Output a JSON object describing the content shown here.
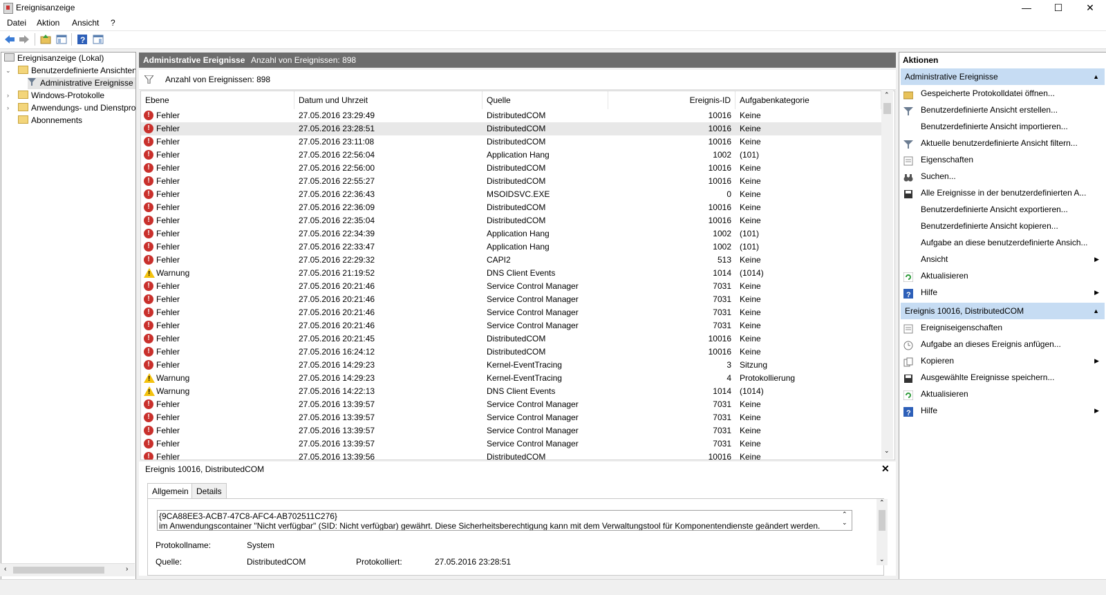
{
  "window": {
    "title": "Ereignisanzeige",
    "min": "—",
    "max": "☐",
    "close": "✕"
  },
  "menu": [
    "Datei",
    "Aktion",
    "Ansicht",
    "?"
  ],
  "tree": [
    {
      "label": "Ereignisanzeige (Lokal)"
    },
    {
      "label": "Benutzerdefinierte Ansichten"
    },
    {
      "label": "Administrative Ereignisse"
    },
    {
      "label": "Windows-Protokolle"
    },
    {
      "label": "Anwendungs- und Dienstprotokolle"
    },
    {
      "label": "Abonnements"
    }
  ],
  "center": {
    "title": "Administrative Ereignisse",
    "count_header": "Anzahl von Ereignissen: 898",
    "filter_text": "Anzahl von Ereignissen: 898",
    "columns": [
      "Ebene",
      "Datum und Uhrzeit",
      "Quelle",
      "Ereignis-ID",
      "Aufgabenkategorie"
    ],
    "rows": [
      {
        "level": "Fehler",
        "type": "error",
        "date": "27.05.2016 23:29:49",
        "source": "DistributedCOM",
        "id": "10016",
        "cat": "Keine"
      },
      {
        "level": "Fehler",
        "type": "error",
        "date": "27.05.2016 23:28:51",
        "source": "DistributedCOM",
        "id": "10016",
        "cat": "Keine"
      },
      {
        "level": "Fehler",
        "type": "error",
        "date": "27.05.2016 23:11:08",
        "source": "DistributedCOM",
        "id": "10016",
        "cat": "Keine"
      },
      {
        "level": "Fehler",
        "type": "error",
        "date": "27.05.2016 22:56:04",
        "source": "Application Hang",
        "id": "1002",
        "cat": "(101)"
      },
      {
        "level": "Fehler",
        "type": "error",
        "date": "27.05.2016 22:56:00",
        "source": "DistributedCOM",
        "id": "10016",
        "cat": "Keine"
      },
      {
        "level": "Fehler",
        "type": "error",
        "date": "27.05.2016 22:55:27",
        "source": "DistributedCOM",
        "id": "10016",
        "cat": "Keine"
      },
      {
        "level": "Fehler",
        "type": "error",
        "date": "27.05.2016 22:36:43",
        "source": "MSOIDSVC.EXE",
        "id": "0",
        "cat": "Keine"
      },
      {
        "level": "Fehler",
        "type": "error",
        "date": "27.05.2016 22:36:09",
        "source": "DistributedCOM",
        "id": "10016",
        "cat": "Keine"
      },
      {
        "level": "Fehler",
        "type": "error",
        "date": "27.05.2016 22:35:04",
        "source": "DistributedCOM",
        "id": "10016",
        "cat": "Keine"
      },
      {
        "level": "Fehler",
        "type": "error",
        "date": "27.05.2016 22:34:39",
        "source": "Application Hang",
        "id": "1002",
        "cat": "(101)"
      },
      {
        "level": "Fehler",
        "type": "error",
        "date": "27.05.2016 22:33:47",
        "source": "Application Hang",
        "id": "1002",
        "cat": "(101)"
      },
      {
        "level": "Fehler",
        "type": "error",
        "date": "27.05.2016 22:29:32",
        "source": "CAPI2",
        "id": "513",
        "cat": "Keine"
      },
      {
        "level": "Warnung",
        "type": "warning",
        "date": "27.05.2016 21:19:52",
        "source": "DNS Client Events",
        "id": "1014",
        "cat": "(1014)"
      },
      {
        "level": "Fehler",
        "type": "error",
        "date": "27.05.2016 20:21:46",
        "source": "Service Control Manager",
        "id": "7031",
        "cat": "Keine"
      },
      {
        "level": "Fehler",
        "type": "error",
        "date": "27.05.2016 20:21:46",
        "source": "Service Control Manager",
        "id": "7031",
        "cat": "Keine"
      },
      {
        "level": "Fehler",
        "type": "error",
        "date": "27.05.2016 20:21:46",
        "source": "Service Control Manager",
        "id": "7031",
        "cat": "Keine"
      },
      {
        "level": "Fehler",
        "type": "error",
        "date": "27.05.2016 20:21:46",
        "source": "Service Control Manager",
        "id": "7031",
        "cat": "Keine"
      },
      {
        "level": "Fehler",
        "type": "error",
        "date": "27.05.2016 20:21:45",
        "source": "DistributedCOM",
        "id": "10016",
        "cat": "Keine"
      },
      {
        "level": "Fehler",
        "type": "error",
        "date": "27.05.2016 16:24:12",
        "source": "DistributedCOM",
        "id": "10016",
        "cat": "Keine"
      },
      {
        "level": "Fehler",
        "type": "error",
        "date": "27.05.2016 14:29:23",
        "source": "Kernel-EventTracing",
        "id": "3",
        "cat": "Sitzung"
      },
      {
        "level": "Warnung",
        "type": "warning",
        "date": "27.05.2016 14:29:23",
        "source": "Kernel-EventTracing",
        "id": "4",
        "cat": "Protokollierung"
      },
      {
        "level": "Warnung",
        "type": "warning",
        "date": "27.05.2016 14:22:13",
        "source": "DNS Client Events",
        "id": "1014",
        "cat": "(1014)"
      },
      {
        "level": "Fehler",
        "type": "error",
        "date": "27.05.2016 13:39:57",
        "source": "Service Control Manager",
        "id": "7031",
        "cat": "Keine"
      },
      {
        "level": "Fehler",
        "type": "error",
        "date": "27.05.2016 13:39:57",
        "source": "Service Control Manager",
        "id": "7031",
        "cat": "Keine"
      },
      {
        "level": "Fehler",
        "type": "error",
        "date": "27.05.2016 13:39:57",
        "source": "Service Control Manager",
        "id": "7031",
        "cat": "Keine"
      },
      {
        "level": "Fehler",
        "type": "error",
        "date": "27.05.2016 13:39:57",
        "source": "Service Control Manager",
        "id": "7031",
        "cat": "Keine"
      },
      {
        "level": "Fehler",
        "type": "error",
        "date": "27.05.2016 13:39:56",
        "source": "DistributedCOM",
        "id": "10016",
        "cat": "Keine"
      }
    ],
    "selected_row": 1
  },
  "detail": {
    "title": "Ereignis 10016, DistributedCOM",
    "tabs": [
      "Allgemein",
      "Details"
    ],
    "desc_line1": "{9CA88EE3-ACB7-47C8-AFC4-AB702511C276}",
    "desc_line2": "im Anwendungscontainer \"Nicht verfügbar\" (SID: Nicht verfügbar) gewährt. Diese Sicherheitsberechtigung kann mit dem Verwaltungstool für Komponentendienste geändert werden.",
    "log_label": "Protokollname:",
    "log_value": "System",
    "source_label": "Quelle:",
    "source_value": "DistributedCOM",
    "logged_label": "Protokolliert:",
    "logged_value": "27.05.2016 23:28:51"
  },
  "actions": {
    "title": "Aktionen",
    "section1": "Administrative Ereignisse",
    "items1": [
      {
        "label": "Gespeicherte Protokolldatei öffnen...",
        "icon": "folder-open-icon",
        "sub": false
      },
      {
        "label": "Benutzerdefinierte Ansicht erstellen...",
        "icon": "filter-icon",
        "sub": false
      },
      {
        "label": "Benutzerdefinierte Ansicht importieren...",
        "icon": "",
        "sub": false
      },
      {
        "label": "Aktuelle benutzerdefinierte Ansicht filtern...",
        "icon": "filter-icon",
        "sub": false
      },
      {
        "label": "Eigenschaften",
        "icon": "properties-icon",
        "sub": false
      },
      {
        "label": "Suchen...",
        "icon": "binoculars-icon",
        "sub": false
      },
      {
        "label": "Alle Ereignisse in der benutzerdefinierten A...",
        "icon": "save-icon",
        "sub": false
      },
      {
        "label": "Benutzerdefinierte Ansicht exportieren...",
        "icon": "",
        "sub": false
      },
      {
        "label": "Benutzerdefinierte Ansicht kopieren...",
        "icon": "",
        "sub": false
      },
      {
        "label": "Aufgabe an diese benutzerdefinierte Ansich...",
        "icon": "",
        "sub": false
      },
      {
        "label": "Ansicht",
        "icon": "",
        "sub": true
      },
      {
        "label": "Aktualisieren",
        "icon": "refresh-icon",
        "sub": false
      },
      {
        "label": "Hilfe",
        "icon": "help-icon",
        "sub": true
      }
    ],
    "section2": "Ereignis 10016, DistributedCOM",
    "items2": [
      {
        "label": "Ereigniseigenschaften",
        "icon": "properties-icon",
        "sub": false
      },
      {
        "label": "Aufgabe an dieses Ereignis anfügen...",
        "icon": "task-icon",
        "sub": false
      },
      {
        "label": "Kopieren",
        "icon": "copy-icon",
        "sub": true
      },
      {
        "label": "Ausgewählte Ereignisse speichern...",
        "icon": "save-icon",
        "sub": false
      },
      {
        "label": "Aktualisieren",
        "icon": "refresh-icon",
        "sub": false
      },
      {
        "label": "Hilfe",
        "icon": "help-icon",
        "sub": true
      }
    ]
  },
  "colors": {
    "error": "#c9302c",
    "warning": "#f4c20d",
    "header_bg": "#6d6d6d",
    "section_bg": "#c6dcf3"
  }
}
